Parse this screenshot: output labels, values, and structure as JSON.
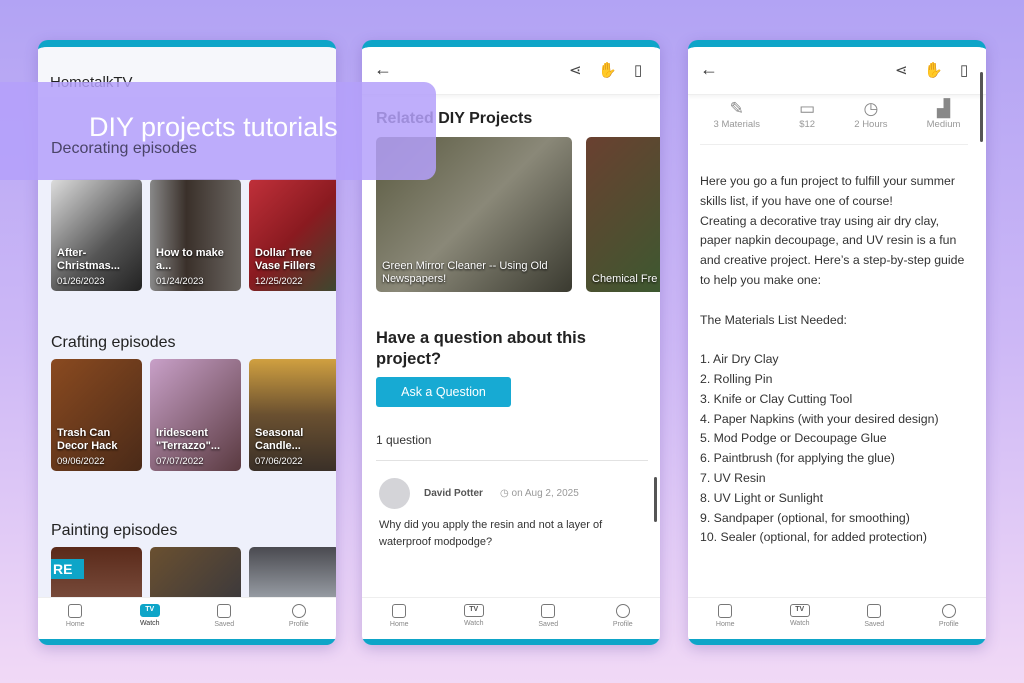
{
  "banner": "DIY projects tutorials",
  "nav": {
    "home": "Home",
    "watch": "Watch",
    "saved": "Saved",
    "profile": "Profile",
    "tv": "TV"
  },
  "screen1": {
    "app_title": "HometalkTV",
    "sections": [
      {
        "title": "Decorating episodes",
        "cards": [
          {
            "title": "After-Christmas...",
            "date": "01/26/2023"
          },
          {
            "title": "How to make a...",
            "date": "01/24/2023"
          },
          {
            "title": "Dollar Tree Vase Fillers",
            "date": "12/25/2022"
          }
        ]
      },
      {
        "title": "Crafting episodes",
        "cards": [
          {
            "title": "Trash Can Decor Hack",
            "date": "09/06/2022"
          },
          {
            "title": "Iridescent \"Terrazzo\"...",
            "date": "07/07/2022"
          },
          {
            "title": "Seasonal Candle...",
            "date": "07/06/2022"
          }
        ]
      },
      {
        "title": "Painting episodes",
        "cards": [
          {
            "title": "",
            "date": "",
            "badge": "RE"
          },
          {
            "title": "",
            "date": ""
          },
          {
            "title": "",
            "date": ""
          }
        ]
      }
    ]
  },
  "screen2": {
    "related_title": "Related DIY Projects",
    "projects": [
      "Green Mirror Cleaner -- Using Old Newspapers!",
      "Chemical Fre"
    ],
    "question_heading": "Have a question about this project?",
    "ask_button": "Ask a Question",
    "count": "1 question",
    "comment": {
      "author": "David Potter",
      "date": "on Aug 2, 2025",
      "text": "Why did you apply the resin and not a layer of waterproof modpodge?"
    }
  },
  "screen3": {
    "stats": [
      "3 Materials",
      "$12",
      "2 Hours",
      "Medium"
    ],
    "intro": [
      "Here you go a fun project to fulfill your summer skills list, if you have one of course!",
      "Creating a decorative tray using air dry clay, paper napkin decoupage, and UV resin is a fun and creative project. Here’s a step-by-step guide to help you make one:"
    ],
    "materials_heading": "The Materials List Needed:",
    "materials": [
      "1. Air Dry Clay",
      "2. Rolling Pin",
      "3. Knife or Clay Cutting Tool",
      "4. Paper Napkins (with your desired design)",
      "5. Mod Podge or Decoupage Glue",
      "6. Paintbrush (for applying the glue)",
      "7. UV Resin",
      "8. UV Light or Sunlight",
      "9. Sandpaper (optional, for smoothing)",
      "10. Sealer (optional, for added protection)"
    ]
  }
}
